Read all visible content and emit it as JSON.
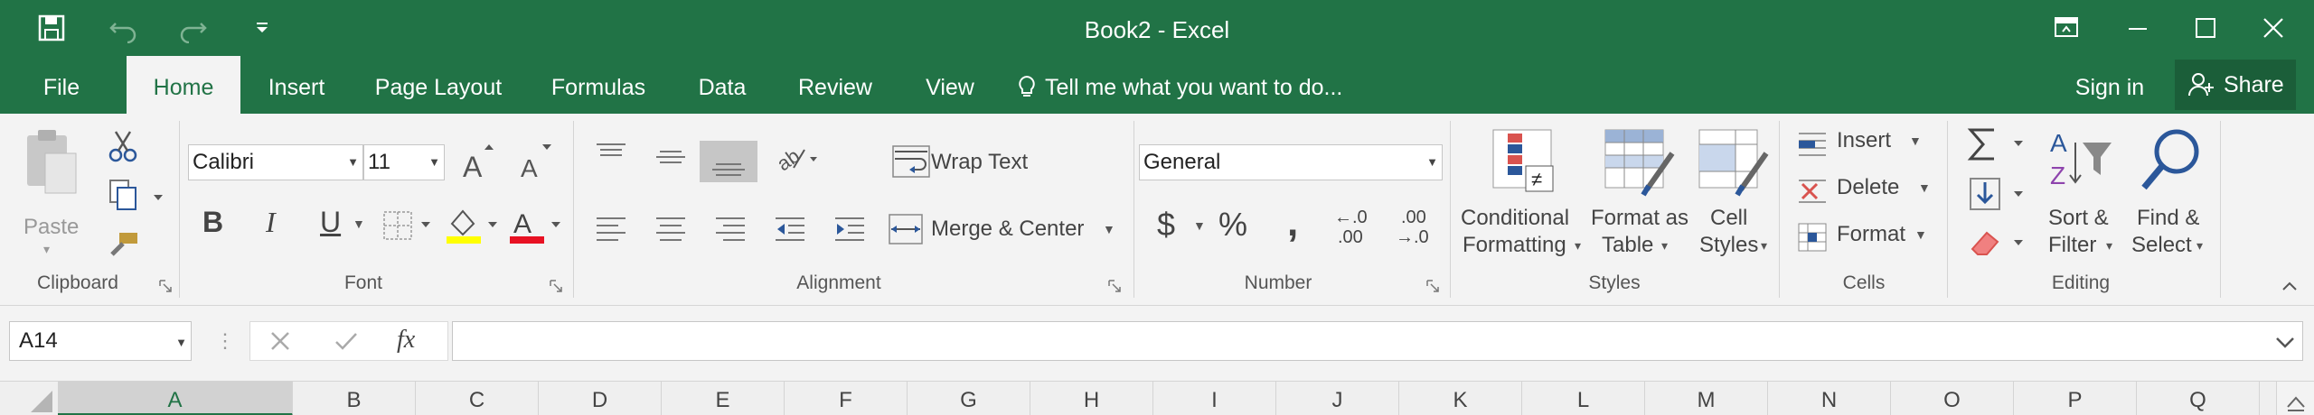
{
  "app": {
    "title": "Book2 - Excel"
  },
  "quick_access": {
    "save": "save-icon",
    "undo": "undo-icon",
    "redo": "redo-icon",
    "customize": "customize-qat-icon"
  },
  "tabs": [
    {
      "label": "File"
    },
    {
      "label": "Home"
    },
    {
      "label": "Insert"
    },
    {
      "label": "Page Layout"
    },
    {
      "label": "Formulas"
    },
    {
      "label": "Data"
    },
    {
      "label": "Review"
    },
    {
      "label": "View"
    }
  ],
  "tell_me": {
    "label": "Tell me what you want to do..."
  },
  "account": {
    "sign_in": "Sign in",
    "share": "Share"
  },
  "clipboard": {
    "paste": "Paste",
    "group": "Clipboard"
  },
  "font": {
    "name": "Calibri",
    "size": "11",
    "group": "Font",
    "bold": "B",
    "italic": "I",
    "underline": "U"
  },
  "alignment": {
    "wrap_text": "Wrap Text",
    "merge_center": "Merge & Center",
    "group": "Alignment"
  },
  "number": {
    "format": "General",
    "currency": "$",
    "percent": "%",
    "comma": ",",
    "group": "Number",
    "inc_decimal_top": "←.0",
    "inc_decimal_bottom": ".00",
    "dec_decimal_top": ".00",
    "dec_decimal_bottom": "→.0"
  },
  "styles": {
    "conditional_1": "Conditional",
    "conditional_2": "Formatting",
    "format_table_1": "Format as",
    "format_table_2": "Table",
    "cell_styles_1": "Cell",
    "cell_styles_2": "Styles",
    "group": "Styles"
  },
  "cells": {
    "insert": "Insert",
    "delete": "Delete",
    "format": "Format",
    "group": "Cells"
  },
  "editing": {
    "sort_1": "Sort &",
    "sort_2": "Filter",
    "find_1": "Find &",
    "find_2": "Select",
    "group": "Editing"
  },
  "formula_bar": {
    "name_box": "A14",
    "fx": "fx",
    "value": ""
  },
  "columns": [
    "A",
    "B",
    "C",
    "D",
    "E",
    "F",
    "G",
    "H",
    "I",
    "J",
    "K",
    "L",
    "M",
    "N",
    "O",
    "P",
    "Q"
  ],
  "colors": {
    "excel_green": "#217346",
    "font_color": "#e81123",
    "highlight": "#ffff00"
  }
}
